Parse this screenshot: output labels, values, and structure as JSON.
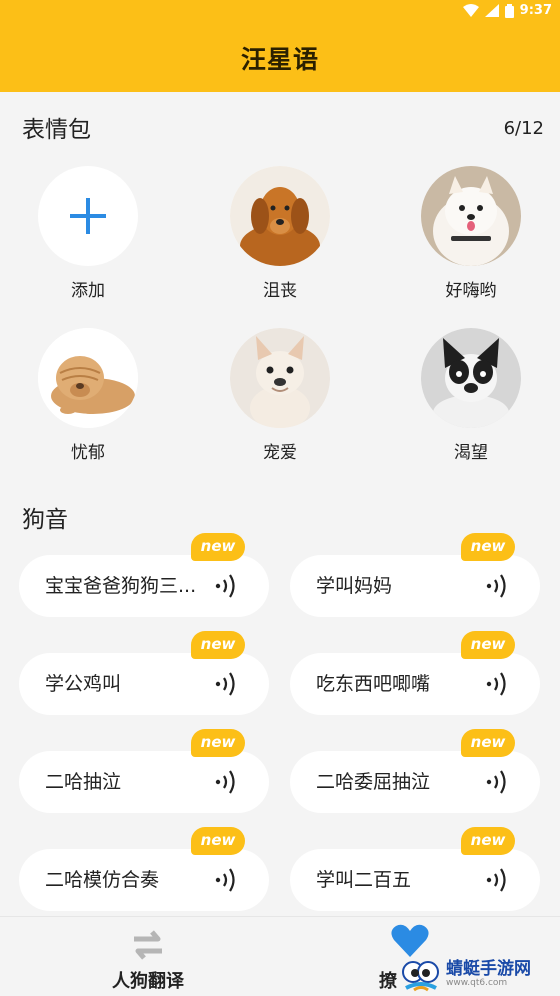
{
  "status": {
    "time": "9:37"
  },
  "appbar": {
    "title": "汪星语"
  },
  "stickers": {
    "title": "表情包",
    "count": "6/12",
    "items": [
      {
        "label": "添加",
        "icon": "add-icon"
      },
      {
        "label": "沮丧",
        "icon": "golden-retriever"
      },
      {
        "label": "好嗨哟",
        "icon": "pomeranian"
      },
      {
        "label": "忧郁",
        "icon": "shar-pei"
      },
      {
        "label": "宠爱",
        "icon": "french-bulldog"
      },
      {
        "label": "渴望",
        "icon": "black-white-bulldog"
      }
    ]
  },
  "sounds": {
    "title": "狗音",
    "badge": "new",
    "items": [
      {
        "label": "宝宝爸爸狗狗三..."
      },
      {
        "label": "学叫妈妈"
      },
      {
        "label": "学公鸡叫"
      },
      {
        "label": "吃东西吧唧嘴"
      },
      {
        "label": "二哈抽泣"
      },
      {
        "label": "二哈委屈抽泣"
      },
      {
        "label": "二哈模仿合奏"
      },
      {
        "label": "学叫二百五"
      }
    ]
  },
  "nav": {
    "translate": "人狗翻译",
    "tease": "撩"
  },
  "watermark": {
    "text": "蜻蜓手游网",
    "sub": "www.qt6.com"
  },
  "colors": {
    "accent": "#fcbf17",
    "plus": "#2b8be3",
    "heart": "#2b8be3"
  }
}
